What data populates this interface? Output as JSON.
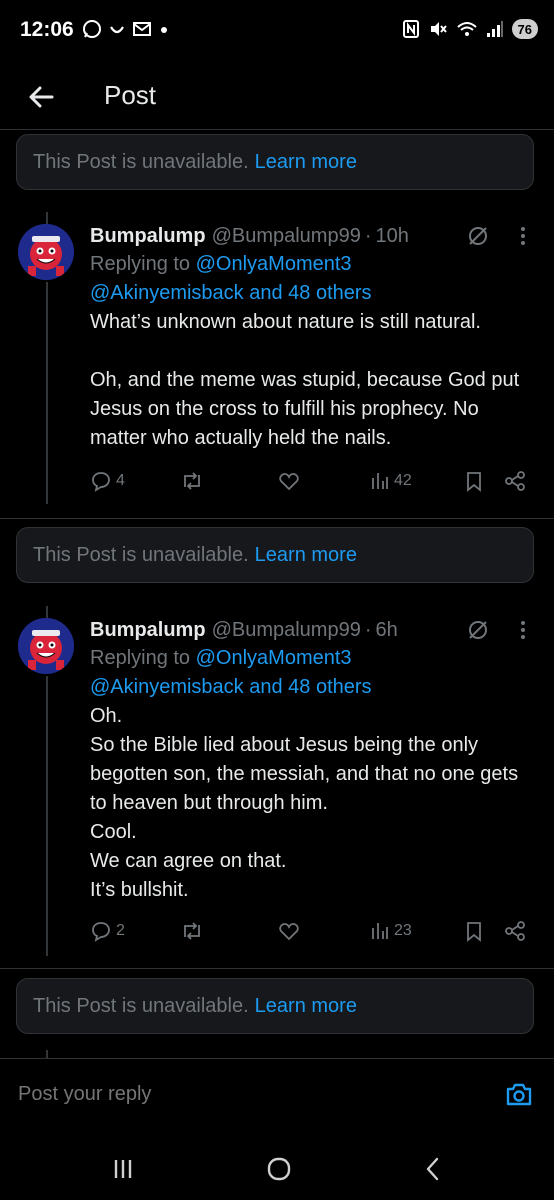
{
  "status": {
    "time": "12:06",
    "battery": "76",
    "signal_sup": "5"
  },
  "header": {
    "title": "Post"
  },
  "unavailable": {
    "text": "This Post is unavailable.",
    "link": "Learn more"
  },
  "posts": [
    {
      "name": "Bumpalump",
      "handle": "@Bumpalump99",
      "dot": "·",
      "time": "10h",
      "replying_prefix": "Replying to",
      "replying_to": "@OnlyaMoment3",
      "replying_more": "@Akinyemisback and 48 others",
      "text": "What’s unknown about nature is still natural.\n\nOh, and the meme was stupid, because God put Jesus on the cross to fulfill his prophecy. No matter who actually held the nails.",
      "replies": "4",
      "views": "42"
    },
    {
      "name": "Bumpalump",
      "handle": "@Bumpalump99",
      "dot": "·",
      "time": "6h",
      "replying_prefix": "Replying to",
      "replying_to": "@OnlyaMoment3",
      "replying_more": "@Akinyemisback and 48 others",
      "text": "Oh.\nSo the Bible lied about Jesus being the only begotten son, the messiah, and that no one gets to heaven but through him.\nCool.\nWe can agree on that.\nIt’s bullshit.",
      "replies": "2",
      "views": "23"
    }
  ],
  "reply_bar": {
    "placeholder": "Post your reply"
  },
  "colors": {
    "accent": "#1d9bf0",
    "muted": "#71767b",
    "background": "#000000"
  }
}
